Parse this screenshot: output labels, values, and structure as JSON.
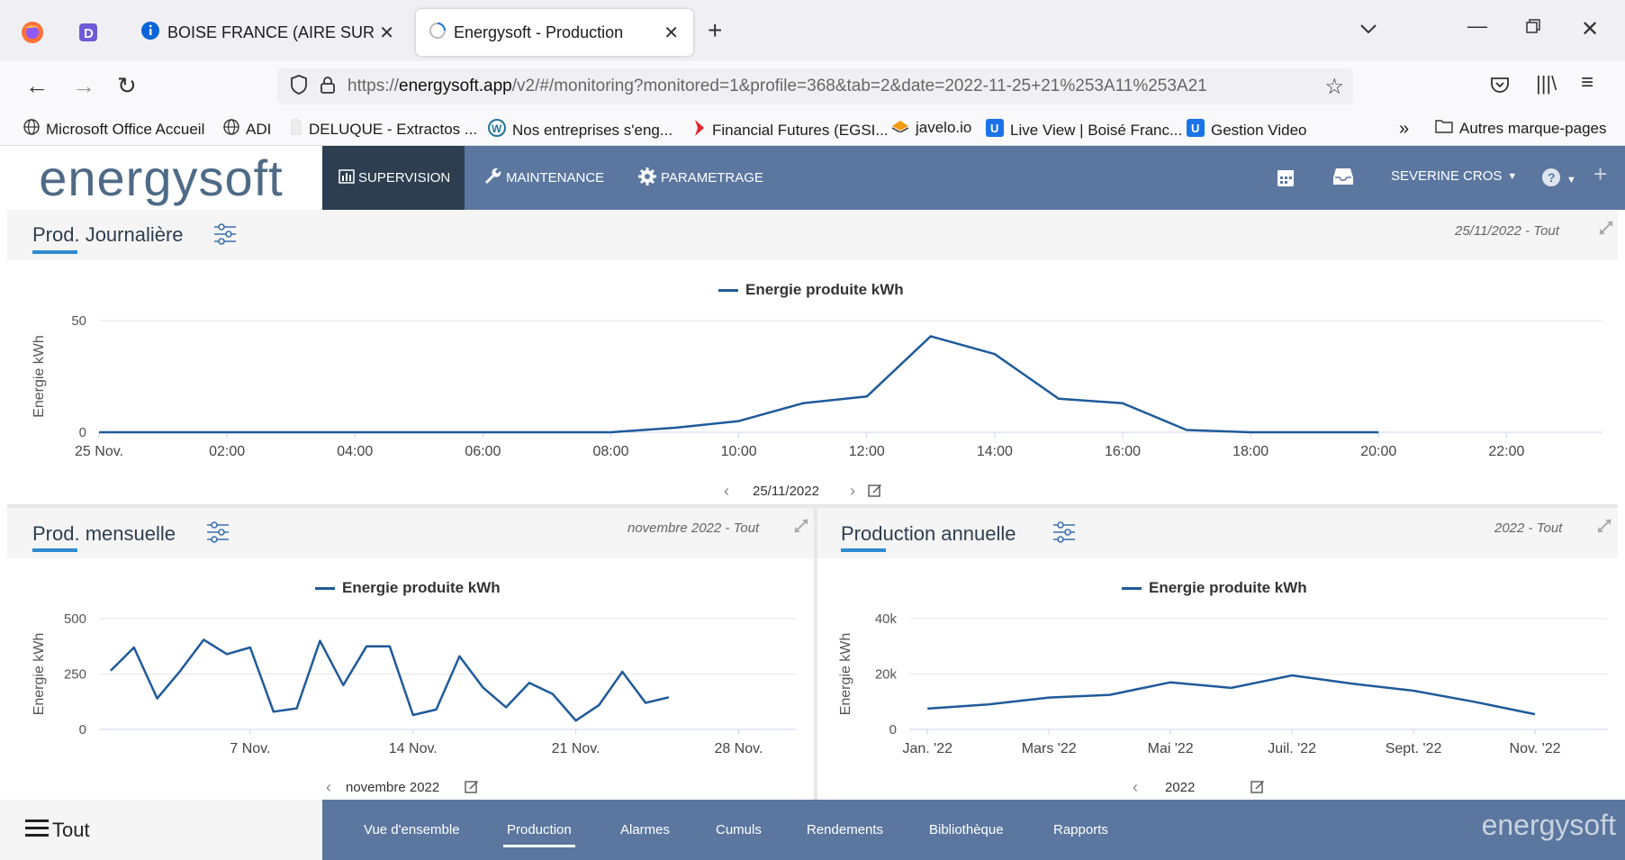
{
  "browser": {
    "tabs": [
      {
        "title": "BOISE FRANCE (AIRE SUR L'ADO",
        "active": false
      },
      {
        "title": "Energysoft - Production",
        "active": true
      }
    ],
    "url_prefix": "https://",
    "url_domain": "energysoft.app",
    "url_path": "/v2/#/monitoring?monitored=1&profile=368&tab=2&date=2022-11-25+21%253A11%253A21",
    "bookmarks": [
      {
        "label": "Microsoft Office Accueil",
        "icon": "globe-icon"
      },
      {
        "label": "ADI",
        "icon": "globe-icon"
      },
      {
        "label": "DELUQUE - Extractos ...",
        "icon": "page-icon"
      },
      {
        "label": "Nos entreprises s'eng...",
        "icon": "wordpress-icon"
      },
      {
        "label": "Financial Futures (EGSI...",
        "icon": "chevron-red-icon"
      },
      {
        "label": "javelo.io",
        "icon": "javelo-icon"
      },
      {
        "label": "Live View | Boisé Franc...",
        "icon": "u-icon"
      },
      {
        "label": "Gestion Video",
        "icon": "u-icon"
      }
    ],
    "other_bookmarks": "Autres marque-pages"
  },
  "app": {
    "logo": "energysoft",
    "nav": [
      {
        "label": "SUPERVISION",
        "active": true,
        "icon": "chart-icon"
      },
      {
        "label": "MAINTENANCE",
        "active": false,
        "icon": "wrench-icon"
      },
      {
        "label": "PARAMETRAGE",
        "active": false,
        "icon": "gear-icon"
      }
    ],
    "user": "SEVERINE CROS"
  },
  "panels": {
    "daily": {
      "title": "Prod. Journalière",
      "meta": "25/11/2022 - Tout",
      "pager_label": "25/11/2022"
    },
    "monthly": {
      "title": "Prod. mensuelle",
      "meta": "novembre 2022 - Tout",
      "pager_label": "novembre 2022"
    },
    "yearly": {
      "title": "Production annuelle",
      "meta": "2022 - Tout",
      "pager_label": "2022"
    }
  },
  "chart_data": [
    {
      "type": "line",
      "legend": "Energie produite kWh",
      "ylabel": "Energie kWh",
      "ylim": [
        0,
        50
      ],
      "yticks": [
        "0",
        "50"
      ],
      "xlim": [
        0,
        23.5
      ],
      "xticks": [
        {
          "v": 0,
          "label": "25 Nov."
        },
        {
          "v": 2,
          "label": "02:00"
        },
        {
          "v": 4,
          "label": "04:00"
        },
        {
          "v": 6,
          "label": "06:00"
        },
        {
          "v": 8,
          "label": "08:00"
        },
        {
          "v": 10,
          "label": "10:00"
        },
        {
          "v": 12,
          "label": "12:00"
        },
        {
          "v": 14,
          "label": "14:00"
        },
        {
          "v": 16,
          "label": "16:00"
        },
        {
          "v": 18,
          "label": "18:00"
        },
        {
          "v": 20,
          "label": "20:00"
        },
        {
          "v": 22,
          "label": "22:00"
        }
      ],
      "x": [
        0,
        1,
        2,
        3,
        4,
        5,
        6,
        7,
        8,
        9,
        10,
        11,
        12,
        13,
        14,
        15,
        16,
        17,
        18,
        19,
        20
      ],
      "values": [
        0,
        0,
        0,
        0,
        0,
        0,
        0,
        0,
        0,
        2,
        5,
        13,
        16,
        43,
        35,
        15,
        13,
        1,
        0,
        0,
        0
      ]
    },
    {
      "type": "line",
      "legend": "Energie produite kWh",
      "ylabel": "Energie kWh",
      "ylim": [
        0,
        500
      ],
      "yticks": [
        "0",
        "250",
        "500"
      ],
      "xlim": [
        0.5,
        30.5
      ],
      "xticks": [
        {
          "v": 7,
          "label": "7 Nov."
        },
        {
          "v": 14,
          "label": "14 Nov."
        },
        {
          "v": 21,
          "label": "21 Nov."
        },
        {
          "v": 28,
          "label": "28 Nov."
        }
      ],
      "x": [
        1,
        2,
        3,
        4,
        5,
        6,
        7,
        8,
        9,
        10,
        11,
        12,
        13,
        14,
        15,
        16,
        17,
        18,
        19,
        20,
        21,
        22,
        23,
        24,
        25
      ],
      "values": [
        265,
        370,
        140,
        265,
        405,
        340,
        370,
        80,
        95,
        400,
        200,
        375,
        375,
        65,
        90,
        330,
        190,
        100,
        210,
        160,
        40,
        110,
        260,
        120,
        145
      ]
    },
    {
      "type": "line",
      "legend": "Energie produite kWh",
      "ylabel": "Energie kWh",
      "ylim": [
        0,
        40000
      ],
      "yticks": [
        "0",
        "20k",
        "40k"
      ],
      "xlim": [
        0.7,
        12.2
      ],
      "xticks": [
        {
          "v": 1,
          "label": "Jan. '22"
        },
        {
          "v": 3,
          "label": "Mars '22"
        },
        {
          "v": 5,
          "label": "Mai '22"
        },
        {
          "v": 7,
          "label": "Juil. '22"
        },
        {
          "v": 9,
          "label": "Sept. '22"
        },
        {
          "v": 11,
          "label": "Nov. '22"
        }
      ],
      "x": [
        1,
        2,
        3,
        4,
        5,
        6,
        7,
        8,
        9,
        10,
        11
      ],
      "values": [
        7500,
        9000,
        11500,
        12500,
        17000,
        15000,
        19500,
        16500,
        14000,
        10000,
        5500
      ]
    }
  ],
  "footer": {
    "menu_label": "Tout",
    "tabs": [
      "Vue d'ensemble",
      "Production",
      "Alarmes",
      "Cumuls",
      "Rendements",
      "Bibliothèque",
      "Rapports"
    ],
    "active_tab": "Production",
    "logo": "energysoft"
  },
  "colors": {
    "header": "#5b77a0",
    "active_nav": "#2c3e50",
    "series": "#1f5a9a",
    "underline": "#2d8bd0"
  }
}
